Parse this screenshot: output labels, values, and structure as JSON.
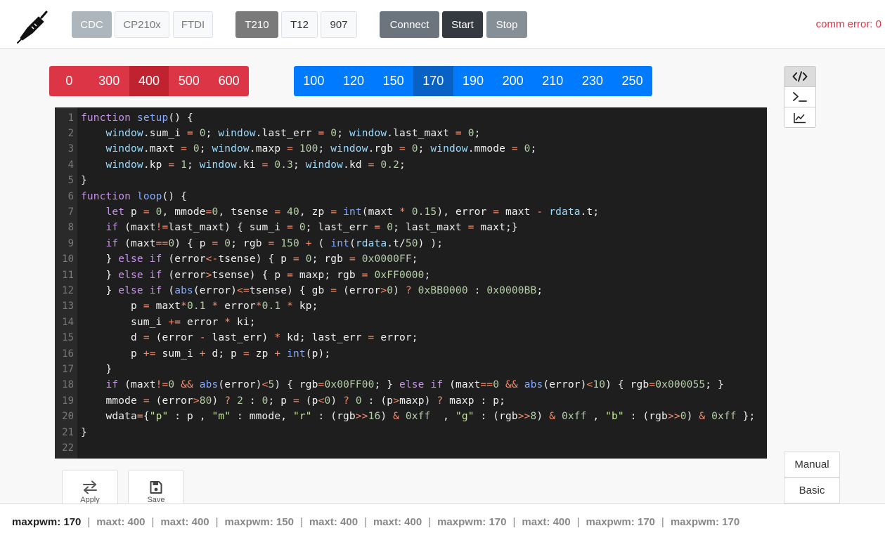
{
  "header": {
    "port_types": [
      {
        "label": "CDC",
        "active": true
      },
      {
        "label": "CP210x",
        "active": false
      },
      {
        "label": "FTDI",
        "active": false
      }
    ],
    "devices": [
      {
        "label": "T210",
        "active": true
      },
      {
        "label": "T12",
        "active": false
      },
      {
        "label": "907",
        "active": false
      }
    ],
    "actions": {
      "connect": "Connect",
      "start": "Start",
      "stop": "Stop"
    },
    "comm_error": "comm error: 0"
  },
  "maxp_presets": {
    "color": "#dc3545",
    "items": [
      "0",
      "300",
      "400",
      "500",
      "600"
    ],
    "active_index": 2
  },
  "maxt_presets": {
    "color": "#007bff",
    "items": [
      "100",
      "120",
      "150",
      "170",
      "190",
      "200",
      "210",
      "230",
      "250"
    ],
    "active_index": 3
  },
  "side_tools": [
    {
      "icon": "code-icon",
      "active": true
    },
    {
      "icon": "terminal-icon",
      "active": false
    },
    {
      "icon": "chart-icon",
      "active": false
    }
  ],
  "editor": {
    "lines": [
      {
        "n": "1",
        "text": "function setup() {"
      },
      {
        "n": "2",
        "text": "    window.sum_i = 0; window.last_err = 0; window.last_maxt = 0;"
      },
      {
        "n": "3",
        "text": "    window.maxt = 0; window.maxp = 100; window.rgb = 0; window.mmode = 0;"
      },
      {
        "n": "4",
        "text": "    window.kp = 1; window.ki = 0.3; window.kd = 0.2;"
      },
      {
        "n": "5",
        "text": "}"
      },
      {
        "n": "6",
        "text": "function loop() {"
      },
      {
        "n": "7",
        "text": "    let p = 0, mmode=0, tsense = 40, zp = int(maxt * 0.15), error = maxt - rdata.t;"
      },
      {
        "n": "8",
        "text": "    if (maxt!=last_maxt) { sum_i = 0; last_err = 0; last_maxt = maxt;}"
      },
      {
        "n": "9",
        "text": "    if (maxt==0) { p = 0; rgb = 150 + ( int(rdata.t/50) );"
      },
      {
        "n": "10",
        "text": "    } else if (error<-tsense) { p = 0; rgb = 0x0000FF;"
      },
      {
        "n": "11",
        "text": "    } else if (error>tsense) { p = maxp; rgb = 0xFF0000;"
      },
      {
        "n": "12",
        "text": "    } else if (abs(error)<=tsense) { gb = (error>0) ? 0xBB0000 : 0x0000BB;"
      },
      {
        "n": "13",
        "text": "        p = maxt*0.1 * error*0.1 * kp;"
      },
      {
        "n": "14",
        "text": "        sum_i += error * ki;"
      },
      {
        "n": "15",
        "text": "        d = (error - last_err) * kd; last_err = error;"
      },
      {
        "n": "16",
        "text": "        p += sum_i + d; p = zp + int(p);"
      },
      {
        "n": "17",
        "text": "    }"
      },
      {
        "n": "18",
        "text": "    if (maxt!=0 && abs(error)<5) { rgb=0x00FF00; } else if (maxt==0 && abs(error)<10) { rgb=0x000055; }"
      },
      {
        "n": "19",
        "text": "    mmode = (error>80) ? 2 : 0; p = (p<0) ? 0 : (p>maxp) ? maxp : p;"
      },
      {
        "n": "20",
        "text": "    wdata={\"p\" : p , \"m\" : mmode, \"r\" : (rgb>>16) & 0xff  , \"g\" : (rgb>>8) & 0xff , \"b\" : (rgb>>0) & 0xff };"
      },
      {
        "n": "21",
        "text": "}"
      },
      {
        "n": "22",
        "text": ""
      }
    ]
  },
  "bottom_actions": {
    "apply": "Apply",
    "save": "Save"
  },
  "modes": {
    "manual": "Manual",
    "basic": "Basic"
  },
  "footer": {
    "entries": [
      "maxpwm: 170",
      "maxt: 400",
      "maxt: 400",
      "maxpwm: 150",
      "maxt: 400",
      "maxt: 400",
      "maxpwm: 170",
      "maxt: 400",
      "maxpwm: 170",
      "maxpwm: 170"
    ],
    "separator": "|"
  }
}
